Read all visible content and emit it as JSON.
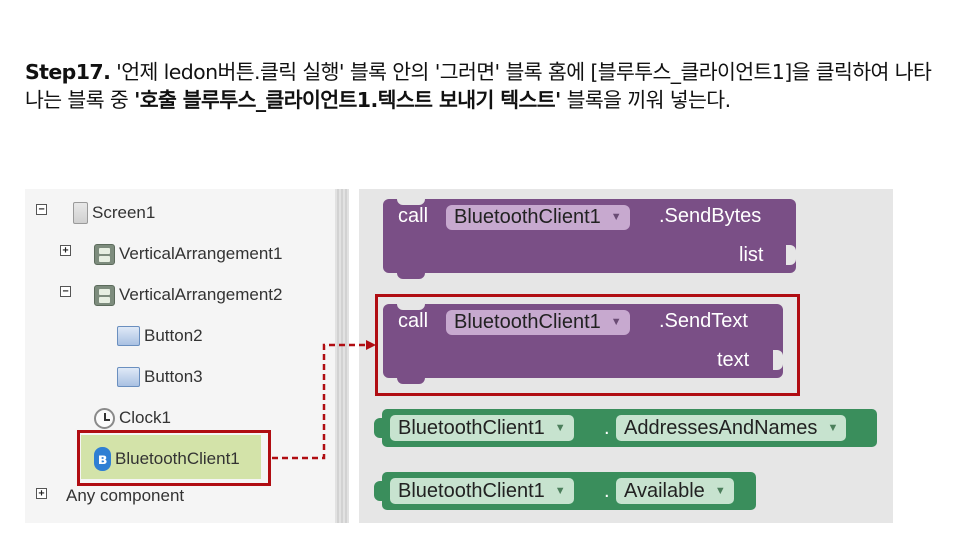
{
  "instruction": {
    "step": "Step17.",
    "part1": " '언제 ledon버튼.클릭 실행' 블록 안의 '그러면' 블록 홈에 [블루투스_클라이언트1]을 클릭하여 나타나는 블록 중 ",
    "highlight": "'호출 블루투스_클라이언트1.텍스트 보내기 텍스트'",
    "part2": " 블록을 끼워 넣는다."
  },
  "tree": {
    "items": [
      {
        "label": "Screen1",
        "toggle": "−",
        "icon": "screen-icon"
      },
      {
        "label": "VerticalArrangement1",
        "toggle": "+",
        "icon": "vertical-arrangement-icon"
      },
      {
        "label": "VerticalArrangement2",
        "toggle": "−",
        "icon": "vertical-arrangement-icon"
      },
      {
        "label": "Button2",
        "icon": "button-icon"
      },
      {
        "label": "Button3",
        "icon": "button-icon"
      },
      {
        "label": "Clock1",
        "icon": "clock-icon"
      },
      {
        "label": "BluetoothClient1",
        "icon": "bluetooth-icon",
        "selected": true
      },
      {
        "label": "Any component",
        "toggle": "+"
      }
    ]
  },
  "blocks": {
    "send_bytes": {
      "call": "call",
      "component": "BluetoothClient1",
      "method": ".SendBytes",
      "arg": "list"
    },
    "send_text": {
      "call": "call",
      "component": "BluetoothClient1",
      "method": ".SendText",
      "arg": "text"
    },
    "addresses": {
      "component": "BluetoothClient1",
      "dot": ".",
      "property": "AddressesAndNames"
    },
    "available": {
      "component": "BluetoothClient1",
      "dot": ".",
      "property": "Available"
    }
  },
  "colors": {
    "highlight_border": "#b00d12",
    "procedure_block": "#7a4f86",
    "getter_block": "#3a8e5c",
    "selected_node": "#d3e3a9"
  }
}
